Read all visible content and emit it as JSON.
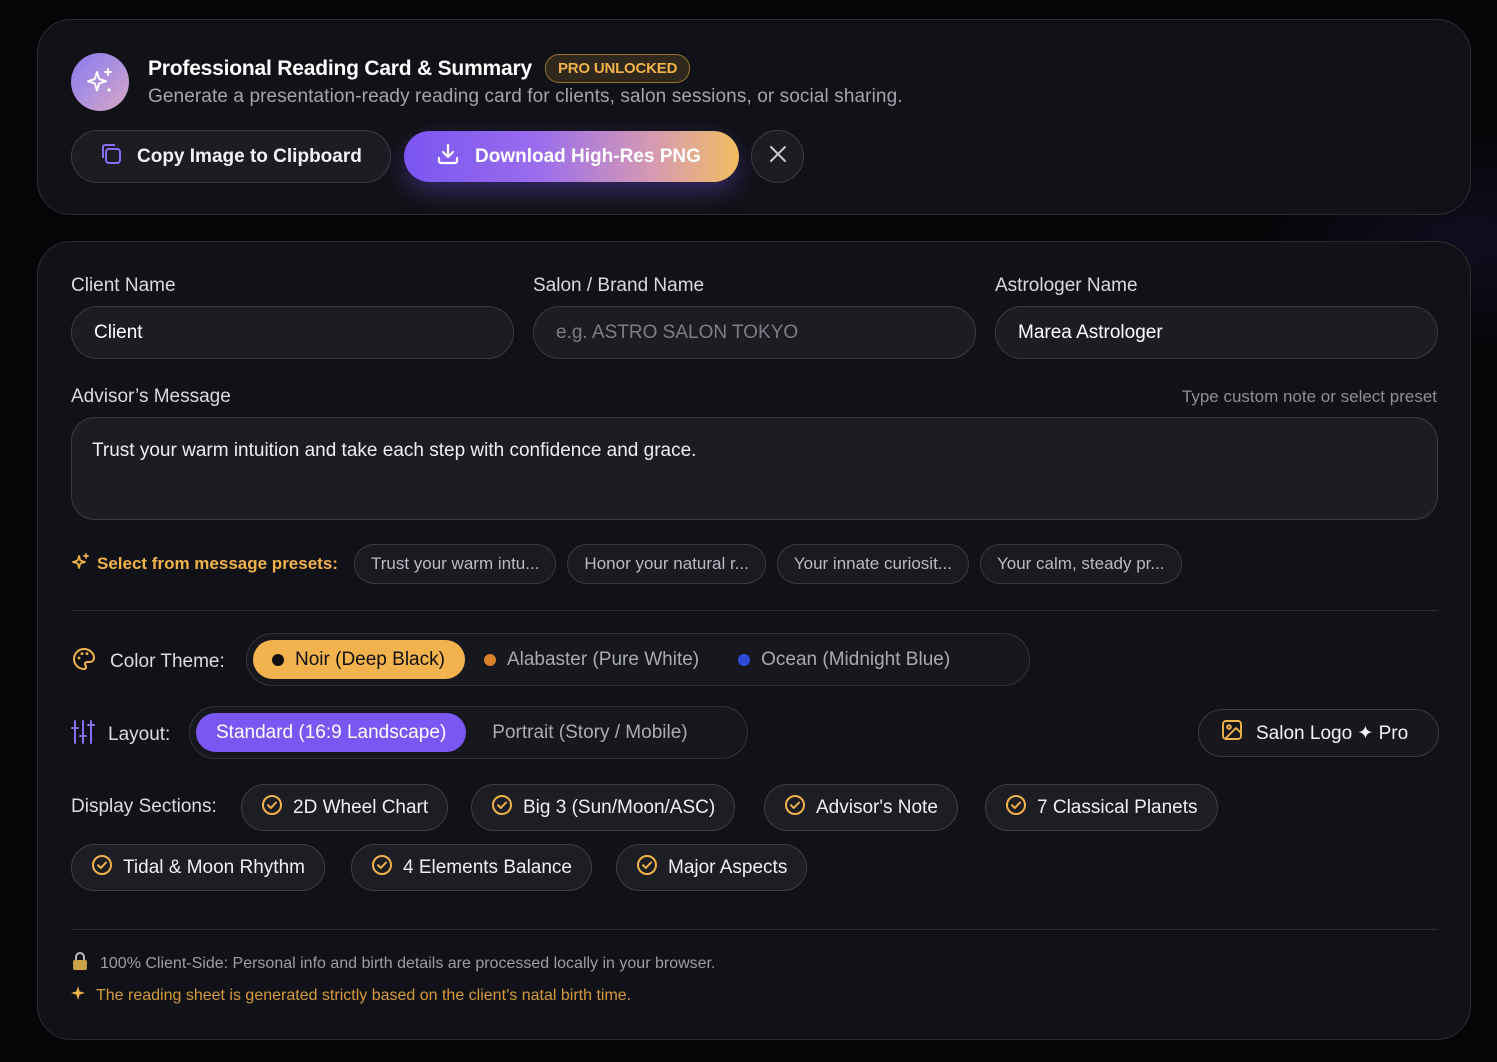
{
  "header": {
    "title": "Professional Reading Card & Summary",
    "badge": "PRO UNLOCKED",
    "subtitle": "Generate a presentation-ready reading card for clients, salon sessions, or social sharing.",
    "icon": "sparkles-icon"
  },
  "actions": {
    "copy_label": "Copy Image to Clipboard",
    "download_label": "Download High-Res PNG"
  },
  "fields": {
    "client": {
      "label": "Client Name",
      "value": "Client",
      "placeholder": ""
    },
    "salon": {
      "label": "Salon / Brand Name",
      "value": "",
      "placeholder": "e.g. ASTRO SALON TOKYO"
    },
    "astrologer": {
      "label": "Astrologer Name",
      "value": "Marea Astrologer",
      "placeholder": ""
    }
  },
  "message": {
    "label": "Advisor’s Message",
    "hint": "Type custom note or select preset",
    "value": "Trust your warm intuition and take each step with confidence and grace."
  },
  "presets": {
    "label": "Select from message presets:",
    "items": [
      "Trust your warm intu...",
      "Honor your natural r...",
      "Your innate curiosit...",
      "Your calm, steady pr..."
    ]
  },
  "theme": {
    "label": "Color Theme:",
    "options": [
      {
        "label": "Noir (Deep Black)",
        "dot": "#111111",
        "active": true
      },
      {
        "label": "Alabaster (Pure White)",
        "dot": "#d9822b",
        "active": false
      },
      {
        "label": "Ocean (Midnight Blue)",
        "dot": "#2f4ad6",
        "active": false
      }
    ]
  },
  "layout": {
    "label": "Layout:",
    "options": [
      {
        "label": "Standard (16:9 Landscape)",
        "active": true
      },
      {
        "label": "Portrait (Story / Mobile)",
        "active": false
      }
    ],
    "logo_button": "Salon Logo ✦ Pro"
  },
  "sections": {
    "label": "Display Sections:",
    "items": [
      "2D Wheel Chart",
      "Big 3 (Sun/Moon/ASC)",
      "Advisor's Note",
      "7 Classical Planets",
      "Tidal & Moon Rhythm",
      "4 Elements Balance",
      "Major Aspects"
    ]
  },
  "notes": {
    "privacy": "100% Client-Side: Personal info and birth details are processed locally in your browser.",
    "basis": "The reading sheet is generated strictly based on the client’s natal birth time."
  },
  "colors": {
    "accent_gold": "#f2b24e",
    "accent_purple": "#7a56f2",
    "panel_bg": "#111217"
  }
}
